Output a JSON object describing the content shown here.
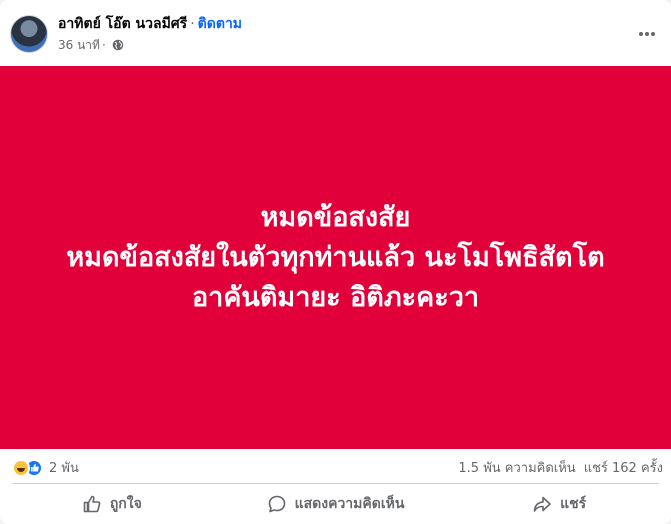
{
  "post": {
    "author": "อาทิตย์ โอ๊ต นวลมีศรี",
    "separator": "·",
    "follow_label": "ติดตาม",
    "timestamp": "36 นาที",
    "meta_separator": "·",
    "privacy_icon": "globe-icon",
    "more_icon": "more-options-icon"
  },
  "banner": {
    "background": "#e1003a",
    "lines": [
      "หมดข้อสงสัย",
      "หมดข้อสงสัยในตัวทุกท่านแล้ว นะโมโพธิสัตโต",
      "อาคันติมายะ อิติภะคะวา"
    ]
  },
  "stats": {
    "reaction_icons": [
      "haha-reaction-icon",
      "like-reaction-icon"
    ],
    "reaction_count": "2 พัน",
    "comments": "1.5 พัน ความคิดเห็น",
    "shares": "แชร์ 162 ครั้ง"
  },
  "actions": {
    "like_label": "ถูกใจ",
    "comment_label": "แสดงความคิดเห็น",
    "share_label": "แชร์"
  }
}
